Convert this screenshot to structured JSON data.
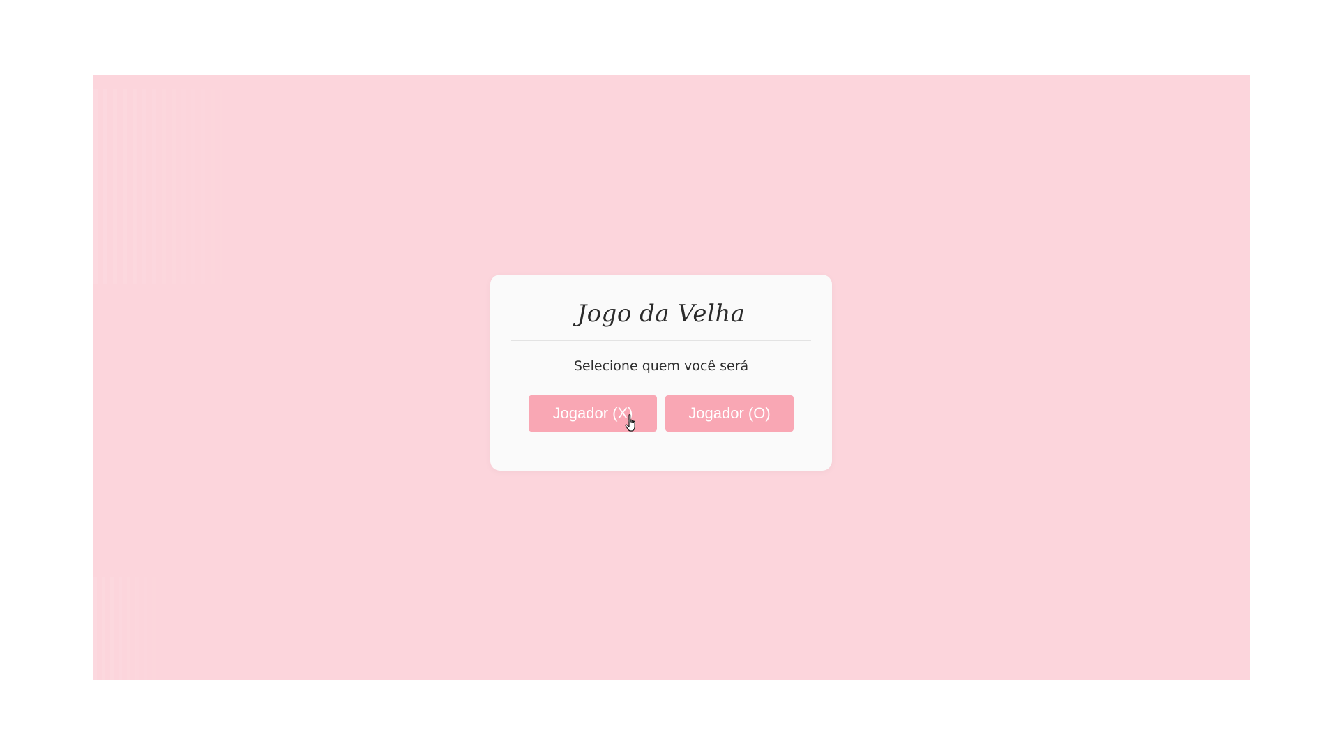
{
  "dialog": {
    "title": "Jogo da Velha",
    "prompt": "Selecione quem você será",
    "buttons": [
      {
        "label": "Jogador (X)"
      },
      {
        "label": "Jogador (O)"
      }
    ]
  },
  "colors": {
    "background": "#fcd5dc",
    "dialog_bg": "#fafafa",
    "button_bg": "#f9a7b4",
    "button_text": "#ffffff"
  },
  "icons": {
    "cursor": "hand-pointer-icon"
  }
}
